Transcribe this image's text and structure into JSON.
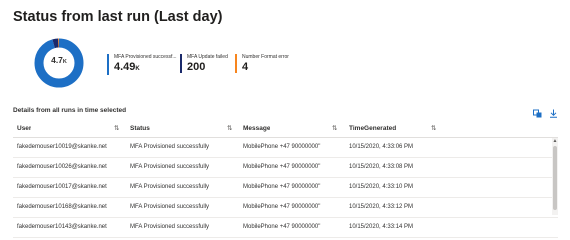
{
  "page": {
    "title": "Status from last run (Last day)"
  },
  "summary": {
    "total_value": "4.7",
    "total_unit": "K",
    "segments": [
      {
        "share": 0.955,
        "color": "#1d6fc5"
      },
      {
        "share": 0.038,
        "color": "#1b2a6b"
      },
      {
        "share": 0.007,
        "color": "#f7851e"
      }
    ],
    "kpis": [
      {
        "label": "MFA Provisioned successf...",
        "value": "4.49",
        "unit": "K",
        "color": "#1d6fc5"
      },
      {
        "label": "MFA Update failed",
        "value": "200",
        "unit": "",
        "color": "#1b2a6b"
      },
      {
        "label": "Number Format error",
        "value": "4",
        "unit": "",
        "color": "#f7851e"
      }
    ]
  },
  "details": {
    "title": "Details from all runs in time selected",
    "sort_icon": "⇅",
    "columns": [
      "User",
      "Status",
      "Message",
      "TimeGenerated"
    ],
    "rows": [
      [
        "fakedemouser10019@skanke.net",
        "MFA Provisioned successfully",
        "MobilePhone +47 90000000\"",
        "10/15/2020, 4:33:06 PM"
      ],
      [
        "fakedemouser10026@skanke.net",
        "MFA Provisioned successfully",
        "MobilePhone +47 90000000\"",
        "10/15/2020, 4:33:08 PM"
      ],
      [
        "fakedemouser10017@skanke.net",
        "MFA Provisioned successfully",
        "MobilePhone +47 90000000\"",
        "10/15/2020, 4:33:10 PM"
      ],
      [
        "fakedemouser10168@skanke.net",
        "MFA Provisioned successfully",
        "MobilePhone +47 90000000\"",
        "10/15/2020, 4:33:12 PM"
      ],
      [
        "fakedemouser10143@skanke.net",
        "MFA Provisioned successfully",
        "MobilePhone +47 90000000\"",
        "10/15/2020, 4:33:14 PM"
      ]
    ]
  },
  "icons": {
    "configure": "columns-config-icon",
    "download": "download-icon"
  }
}
